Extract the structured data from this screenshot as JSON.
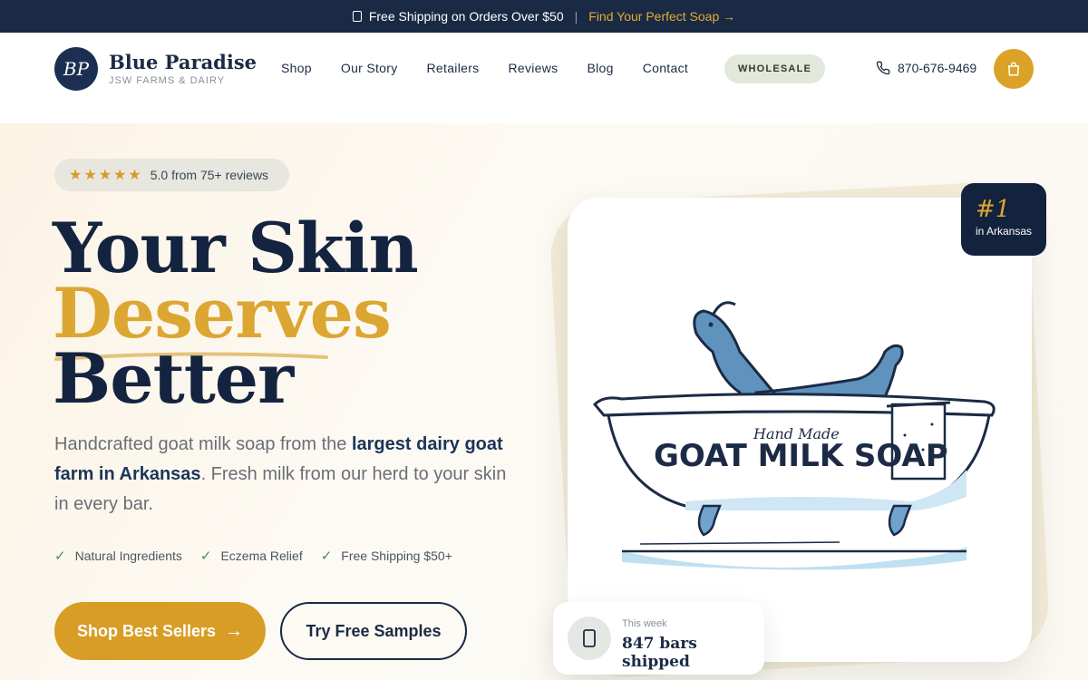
{
  "announcement": {
    "shipping_text": "Free Shipping on Orders Over $50",
    "separator": "|",
    "promo_link": "Find Your Perfect Soap →"
  },
  "brand": {
    "logo_initials": "BP",
    "name": "Blue Paradise",
    "subtitle": "JSW FARMS & DAIRY"
  },
  "nav": {
    "items": [
      "Shop",
      "Our Story",
      "Retailers",
      "Reviews",
      "Blog",
      "Contact"
    ],
    "wholesale_label": "WHOLESALE",
    "phone": "870-676-9469"
  },
  "hero": {
    "rating_stars": "★★★★★",
    "rating_text": "5.0 from 75+ reviews",
    "headline_line1": "Your Skin",
    "headline_line2": "Deserves",
    "headline_line3": "Better",
    "lead_before": "Handcrafted goat milk soap from the ",
    "lead_bold": "largest dairy goat farm in Arkansas",
    "lead_after": ". Fresh milk from our herd to your skin in every bar.",
    "features": [
      "Natural Ingredients",
      "Eczema Relief",
      "Free Shipping $50+"
    ],
    "primary_button": "Shop Best Sellers",
    "primary_arrow": "→",
    "secondary_button": "Try Free Samples"
  },
  "product": {
    "tub_script": "Hand Made",
    "tub_title": "GOAT MILK SOAP",
    "rank_number": "#1",
    "rank_label": "in Arkansas",
    "shipped_caption": "This week",
    "shipped_value": "847 bars shipped"
  },
  "colors": {
    "navy": "#1a2a44",
    "gold": "#dca633",
    "cream": "#fbf8f2",
    "sage": "#e3e8dd"
  },
  "icons": [
    "truck-icon",
    "phone-icon",
    "bag-icon",
    "star-icon",
    "check-icon",
    "arrow-right-icon",
    "box-icon"
  ]
}
